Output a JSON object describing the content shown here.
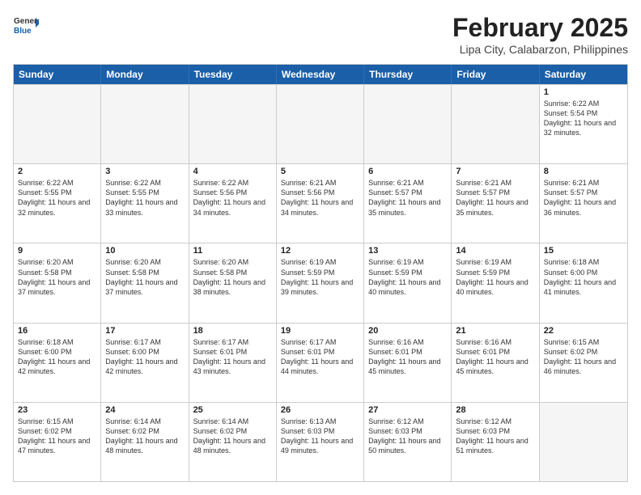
{
  "header": {
    "logo": {
      "line1": "General",
      "line2": "Blue"
    },
    "title": "February 2025",
    "subtitle": "Lipa City, Calabarzon, Philippines"
  },
  "days": [
    "Sunday",
    "Monday",
    "Tuesday",
    "Wednesday",
    "Thursday",
    "Friday",
    "Saturday"
  ],
  "weeks": [
    [
      {
        "day": "",
        "empty": true
      },
      {
        "day": "",
        "empty": true
      },
      {
        "day": "",
        "empty": true
      },
      {
        "day": "",
        "empty": true
      },
      {
        "day": "",
        "empty": true
      },
      {
        "day": "",
        "empty": true
      },
      {
        "day": "1",
        "sunrise": "6:22 AM",
        "sunset": "5:54 PM",
        "daylight": "11 hours and 32 minutes."
      }
    ],
    [
      {
        "day": "2",
        "sunrise": "6:22 AM",
        "sunset": "5:55 PM",
        "daylight": "11 hours and 32 minutes."
      },
      {
        "day": "3",
        "sunrise": "6:22 AM",
        "sunset": "5:55 PM",
        "daylight": "11 hours and 33 minutes."
      },
      {
        "day": "4",
        "sunrise": "6:22 AM",
        "sunset": "5:56 PM",
        "daylight": "11 hours and 34 minutes."
      },
      {
        "day": "5",
        "sunrise": "6:21 AM",
        "sunset": "5:56 PM",
        "daylight": "11 hours and 34 minutes."
      },
      {
        "day": "6",
        "sunrise": "6:21 AM",
        "sunset": "5:57 PM",
        "daylight": "11 hours and 35 minutes."
      },
      {
        "day": "7",
        "sunrise": "6:21 AM",
        "sunset": "5:57 PM",
        "daylight": "11 hours and 35 minutes."
      },
      {
        "day": "8",
        "sunrise": "6:21 AM",
        "sunset": "5:57 PM",
        "daylight": "11 hours and 36 minutes."
      }
    ],
    [
      {
        "day": "9",
        "sunrise": "6:20 AM",
        "sunset": "5:58 PM",
        "daylight": "11 hours and 37 minutes."
      },
      {
        "day": "10",
        "sunrise": "6:20 AM",
        "sunset": "5:58 PM",
        "daylight": "11 hours and 37 minutes."
      },
      {
        "day": "11",
        "sunrise": "6:20 AM",
        "sunset": "5:58 PM",
        "daylight": "11 hours and 38 minutes."
      },
      {
        "day": "12",
        "sunrise": "6:19 AM",
        "sunset": "5:59 PM",
        "daylight": "11 hours and 39 minutes."
      },
      {
        "day": "13",
        "sunrise": "6:19 AM",
        "sunset": "5:59 PM",
        "daylight": "11 hours and 40 minutes."
      },
      {
        "day": "14",
        "sunrise": "6:19 AM",
        "sunset": "5:59 PM",
        "daylight": "11 hours and 40 minutes."
      },
      {
        "day": "15",
        "sunrise": "6:18 AM",
        "sunset": "6:00 PM",
        "daylight": "11 hours and 41 minutes."
      }
    ],
    [
      {
        "day": "16",
        "sunrise": "6:18 AM",
        "sunset": "6:00 PM",
        "daylight": "11 hours and 42 minutes."
      },
      {
        "day": "17",
        "sunrise": "6:17 AM",
        "sunset": "6:00 PM",
        "daylight": "11 hours and 42 minutes."
      },
      {
        "day": "18",
        "sunrise": "6:17 AM",
        "sunset": "6:01 PM",
        "daylight": "11 hours and 43 minutes."
      },
      {
        "day": "19",
        "sunrise": "6:17 AM",
        "sunset": "6:01 PM",
        "daylight": "11 hours and 44 minutes."
      },
      {
        "day": "20",
        "sunrise": "6:16 AM",
        "sunset": "6:01 PM",
        "daylight": "11 hours and 45 minutes."
      },
      {
        "day": "21",
        "sunrise": "6:16 AM",
        "sunset": "6:01 PM",
        "daylight": "11 hours and 45 minutes."
      },
      {
        "day": "22",
        "sunrise": "6:15 AM",
        "sunset": "6:02 PM",
        "daylight": "11 hours and 46 minutes."
      }
    ],
    [
      {
        "day": "23",
        "sunrise": "6:15 AM",
        "sunset": "6:02 PM",
        "daylight": "11 hours and 47 minutes."
      },
      {
        "day": "24",
        "sunrise": "6:14 AM",
        "sunset": "6:02 PM",
        "daylight": "11 hours and 48 minutes."
      },
      {
        "day": "25",
        "sunrise": "6:14 AM",
        "sunset": "6:02 PM",
        "daylight": "11 hours and 48 minutes."
      },
      {
        "day": "26",
        "sunrise": "6:13 AM",
        "sunset": "6:03 PM",
        "daylight": "11 hours and 49 minutes."
      },
      {
        "day": "27",
        "sunrise": "6:12 AM",
        "sunset": "6:03 PM",
        "daylight": "11 hours and 50 minutes."
      },
      {
        "day": "28",
        "sunrise": "6:12 AM",
        "sunset": "6:03 PM",
        "daylight": "11 hours and 51 minutes."
      },
      {
        "day": "",
        "empty": true
      }
    ]
  ]
}
